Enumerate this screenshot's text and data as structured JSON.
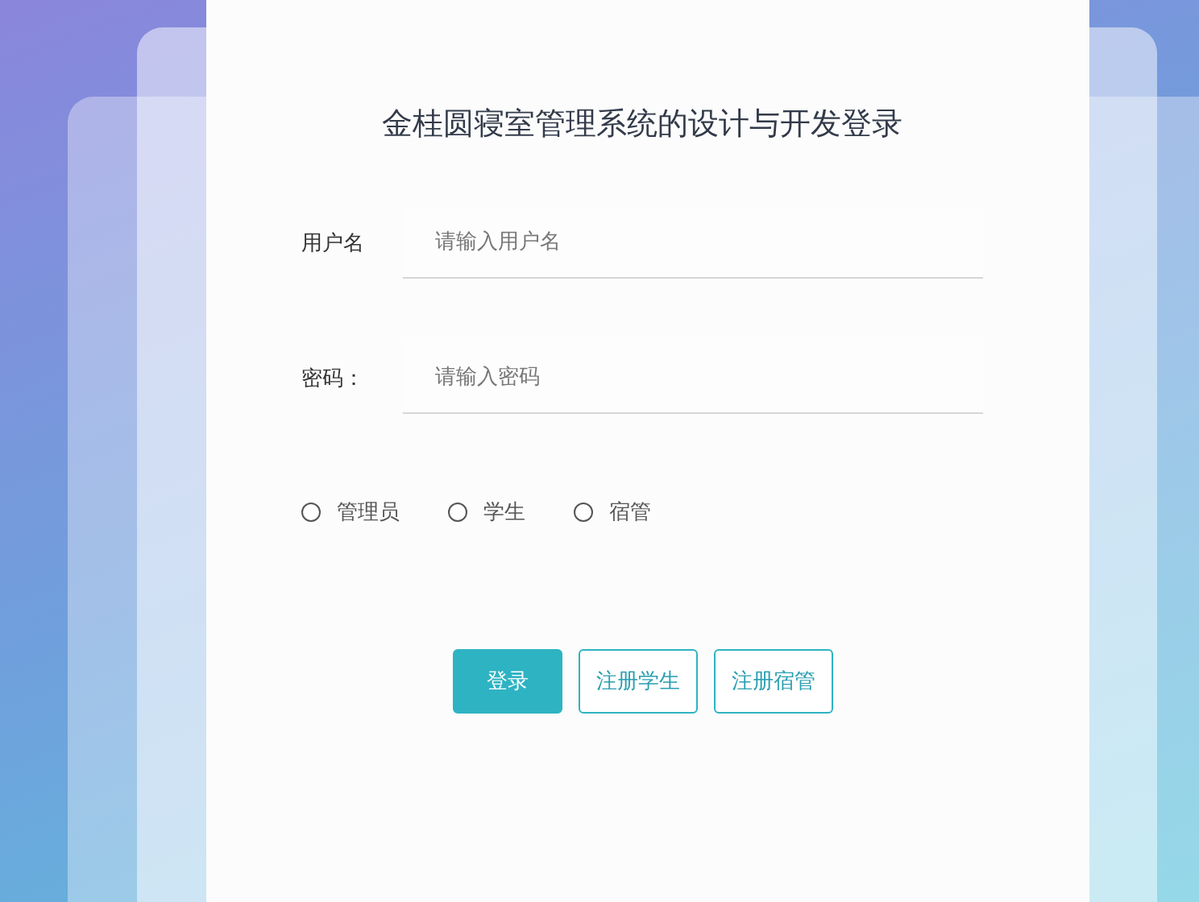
{
  "title": "金桂圆寝室管理系统的设计与开发登录",
  "fields": [
    {
      "label": "用户名",
      "placeholder": "请输入用户名"
    },
    {
      "label": "密码：",
      "placeholder": "请输入密码"
    }
  ],
  "roles": [
    {
      "label": "管理员",
      "selected": false
    },
    {
      "label": "学生",
      "selected": false
    },
    {
      "label": "宿管",
      "selected": false
    }
  ],
  "buttons": [
    {
      "label": "登录",
      "kind": "primary"
    },
    {
      "label": "注册学生",
      "kind": "outline"
    },
    {
      "label": "注册宿管",
      "kind": "outline"
    }
  ]
}
